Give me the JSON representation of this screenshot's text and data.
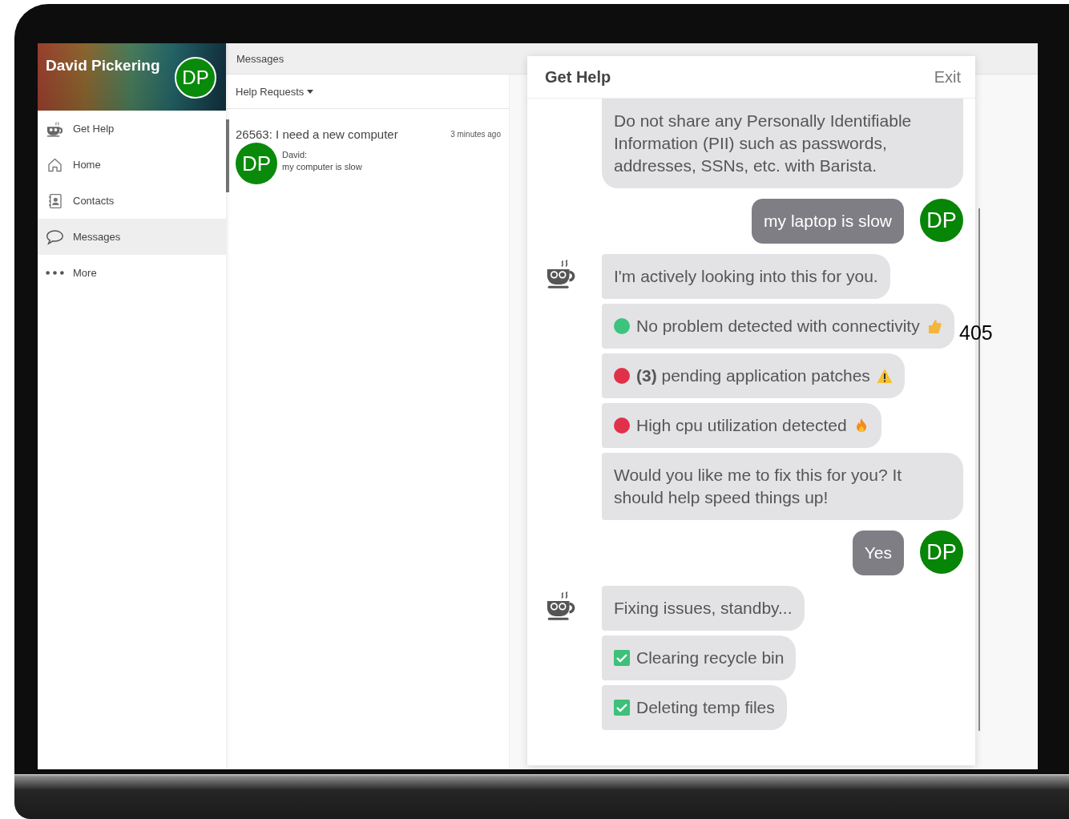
{
  "sidebar": {
    "user_name": "David Pickering",
    "avatar": "DP",
    "items": [
      {
        "label": "Get Help",
        "selected": false
      },
      {
        "label": "Home",
        "selected": false
      },
      {
        "label": "Contacts",
        "selected": false
      },
      {
        "label": "Messages",
        "selected": true
      },
      {
        "label": "More",
        "selected": false
      }
    ]
  },
  "messages_panel": {
    "title": "Messages",
    "filter": "Help Requests",
    "conversations": [
      {
        "title": "26563: I need a new computer",
        "time": "3 minutes ago",
        "avatar": "DP",
        "sender": "David:",
        "preview": "my computer is slow",
        "selected": true
      }
    ]
  },
  "dialog": {
    "title": "Get Help",
    "exit": "Exit",
    "messages": [
      {
        "kind": "text",
        "avatar": false,
        "text": "Do not share any Personally Identifiable Information (PII) such as passwords, addresses, SSNs, etc. with Barista."
      },
      {
        "kind": "user",
        "initials": "DP",
        "text": "my laptop is slow"
      },
      {
        "kind": "text",
        "avatar": true,
        "text": "I'm actively looking into this for you."
      },
      {
        "kind": "ok",
        "avatar": false,
        "color": "#3cc47c",
        "text": "No problem detected with connectivity"
      },
      {
        "kind": "warning",
        "avatar": false,
        "color": "#e0314b",
        "text": "**(3)** pending application patches"
      },
      {
        "kind": "alert",
        "avatar": false,
        "color": "#e0314b",
        "text": "High cpu utilization detected"
      },
      {
        "kind": "text",
        "avatar": false,
        "text": "Would you like me to fix this for you? It should help speed things up!"
      },
      {
        "kind": "user",
        "initials": "DP",
        "text": "Yes"
      },
      {
        "kind": "text",
        "avatar": true,
        "text": "Fixing issues, standby..."
      },
      {
        "kind": "done",
        "avatar": false,
        "text": "Clearing recycle bin"
      },
      {
        "kind": "done",
        "avatar": false,
        "text": "Deleting temp files"
      }
    ]
  },
  "overlay_number": "405"
}
